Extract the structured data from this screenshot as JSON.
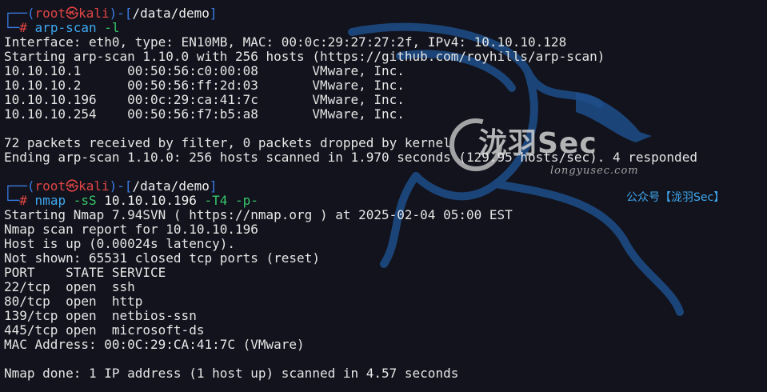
{
  "prompt1": {
    "user": "root",
    "skull": "㉿",
    "host": "kali",
    "path": "/data/demo",
    "hash": "#",
    "cmd": "arp-scan",
    "arg": "-l"
  },
  "arp": {
    "line1": "Interface: eth0, type: EN10MB, MAC: 00:0c:29:27:27:2f, IPv4: 10.10.10.128",
    "line2": "Starting arp-scan 1.10.0 with 256 hosts (https://github.com/royhills/arp-scan)",
    "rows": [
      {
        "ip": "10.10.10.1",
        "mac": "00:50:56:c0:00:08",
        "vendor": "VMware, Inc."
      },
      {
        "ip": "10.10.10.2",
        "mac": "00:50:56:ff:2d:03",
        "vendor": "VMware, Inc."
      },
      {
        "ip": "10.10.10.196",
        "mac": "00:0c:29:ca:41:7c",
        "vendor": "VMware, Inc."
      },
      {
        "ip": "10.10.10.254",
        "mac": "00:50:56:f7:b5:a8",
        "vendor": "VMware, Inc."
      }
    ],
    "summary1": "72 packets received by filter, 0 packets dropped by kernel",
    "summary2": "Ending arp-scan 1.10.0: 256 hosts scanned in 1.970 seconds (129.95 hosts/sec). 4 responded"
  },
  "prompt2": {
    "user": "root",
    "skull": "㉿",
    "host": "kali",
    "path": "/data/demo",
    "hash": "#",
    "cmd": "nmap",
    "flag1": "-sS",
    "target": "10.10.10.196",
    "flag2": "-T4",
    "flag3": "-p-"
  },
  "nmap": {
    "l1": "Starting Nmap 7.94SVN ( https://nmap.org ) at 2025-02-04 05:00 EST",
    "l2": "Nmap scan report for 10.10.10.196",
    "l3": "Host is up (0.00024s latency).",
    "l4": "Not shown: 65531 closed tcp ports (reset)",
    "header": "PORT    STATE SERVICE",
    "ports": [
      "22/tcp  open  ssh",
      "80/tcp  open  http",
      "139/tcp open  netbios-ssn",
      "445/tcp open  microsoft-ds"
    ],
    "mac": "MAC Address: 00:0C:29:CA:41:7C (VMware)",
    "done": "Nmap done: 1 IP address (1 host up) scanned in 4.57 seconds"
  },
  "watermark": {
    "title": "泷羽Sec",
    "domain": "longyusec.com",
    "wechat": "公众号【泷羽Sec】"
  },
  "colors": {
    "background": "#12131c",
    "prompt_blue": "#3b7ce6",
    "prompt_red": "#e24545",
    "cmd_cyan": "#3fa8f0"
  }
}
